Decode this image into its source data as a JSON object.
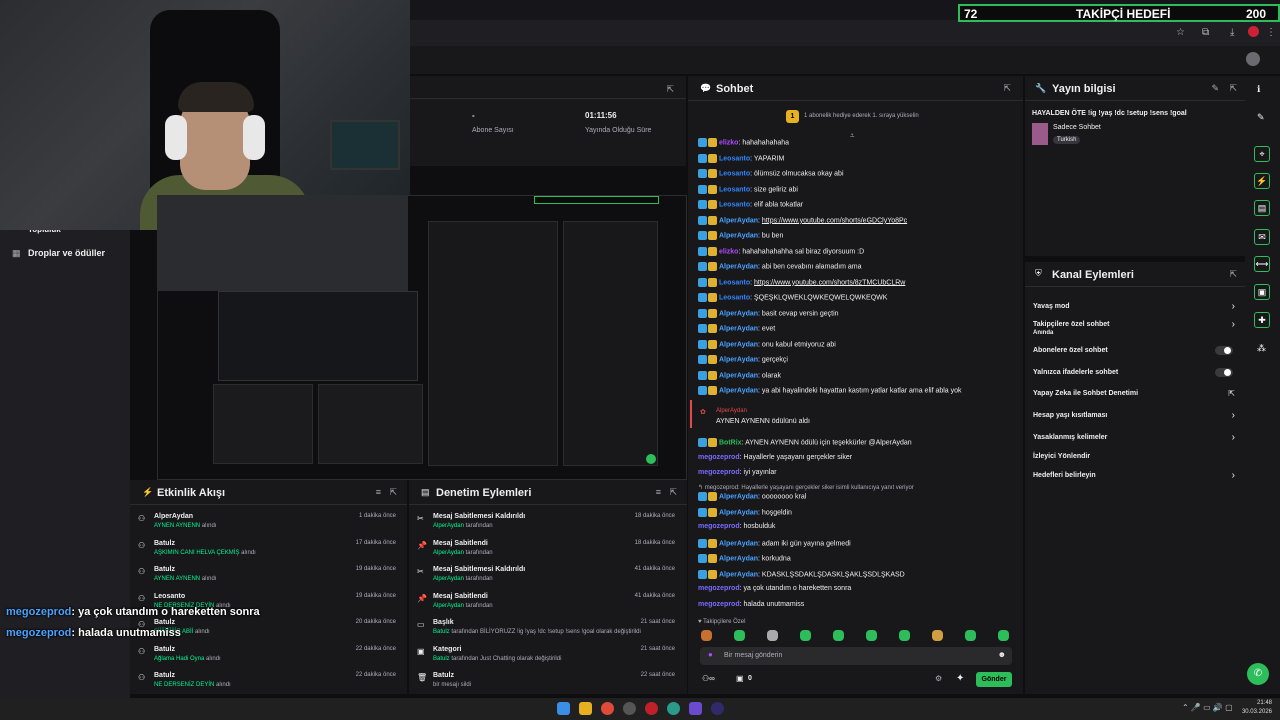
{
  "follow_goal": {
    "count": "72",
    "label": "TAKİPÇİ HEDEFİ",
    "goal": "200"
  },
  "left_nav": {
    "drops_label": "Droplar ve ödüller",
    "top_item": "Topluluk"
  },
  "stats": {
    "followers_value": "-",
    "followers_label": "Abone Sayısı",
    "uptime_value": "01:11:56",
    "uptime_label": "Yayında Olduğu Süre"
  },
  "chat": {
    "title": "Sohbet",
    "pinned": "1 abonelik hediye ederek 1. sıraya yükselin",
    "messages": [
      {
        "user": "elizko",
        "cls": "u-elizko",
        "text": "hahahahahaha"
      },
      {
        "user": "Leosanto",
        "cls": "u-leo",
        "text": "YAPARIM"
      },
      {
        "user": "Leosanto",
        "cls": "u-leo",
        "text": "ölümsüz olmucaksa okay abi"
      },
      {
        "user": "Leosanto",
        "cls": "u-leo",
        "text": "size geliriz abi"
      },
      {
        "user": "Leosanto",
        "cls": "u-leo",
        "text": "elif abla tokatlar"
      },
      {
        "user": "AlperAydan",
        "cls": "u-alper",
        "text": "https://www.youtube.com/shorts/eGDClyYo8Pc",
        "link": true
      },
      {
        "user": "AlperAydan",
        "cls": "u-alper",
        "text": "bu ben"
      },
      {
        "user": "elizko",
        "cls": "u-elizko",
        "text": "hahahahahahha sal biraz diyorsuum :D"
      },
      {
        "user": "AlperAydan",
        "cls": "u-alper",
        "text": "abi ben cevabını alamadım ama"
      },
      {
        "user": "Leosanto",
        "cls": "u-leo",
        "text": "https://www.youtube.com/shorts/8zTMCUbCLRw",
        "link": true
      },
      {
        "user": "Leosanto",
        "cls": "u-leo",
        "text": "ŞQEŞKLQWEKLQWKEQWELQWKEQWK"
      },
      {
        "user": "AlperAydan",
        "cls": "u-alper",
        "text": "basit cevap versin geçtin"
      },
      {
        "user": "AlperAydan",
        "cls": "u-alper",
        "text": "evet"
      },
      {
        "user": "AlperAydan",
        "cls": "u-alper",
        "text": "onu kabul etmiyoruz abi"
      },
      {
        "user": "AlperAydan",
        "cls": "u-alper",
        "text": "gerçekçi"
      },
      {
        "user": "AlperAydan",
        "cls": "u-alper",
        "text": "olarak"
      },
      {
        "user": "AlperAydan",
        "cls": "u-alper",
        "text": "ya abi hayalindeki hayattan kastım yatlar katlar ama elif abla yok"
      }
    ],
    "reward": {
      "user": "AlperAydan",
      "text": "AYNEN AYNENN ödülünü aldı"
    },
    "messages2": [
      {
        "user": "BotRix",
        "cls": "u-botrix",
        "text": "AYNEN AYNENN ödülü için teşekkürler @AlperAydan"
      },
      {
        "user": "megozeprod",
        "cls": "u-mego",
        "text": "Hayallerle yaşayanı gerçekler siker"
      },
      {
        "user": "megozeprod",
        "cls": "u-mego",
        "text": "iyi yayınlar"
      }
    ],
    "reply_ref": "megozeprod: Hayallerle yaşayanı gerçekler siker isimli kullanıcıya yanıt veriyor",
    "messages3": [
      {
        "user": "AlperAydan",
        "cls": "u-alper",
        "text": "oooooooo kral"
      },
      {
        "user": "AlperAydan",
        "cls": "u-alper",
        "text": "hoşgeldin"
      },
      {
        "user": "megozeprod",
        "cls": "u-mego",
        "text": "hosbulduk"
      },
      {
        "user": "AlperAydan",
        "cls": "u-alper",
        "text": "adam iki gün yayına gelmedi"
      },
      {
        "user": "AlperAydan",
        "cls": "u-alper",
        "text": "korkudna"
      },
      {
        "user": "AlperAydan",
        "cls": "u-alper",
        "text": "KDASKLŞSDAKLŞDASKLŞAKLŞSDLŞKASD"
      },
      {
        "user": "megozeprod",
        "cls": "u-mego",
        "text": "ya çok utandım o hareketten sonra"
      },
      {
        "user": "megozeprod",
        "cls": "u-mego",
        "text": "halada unutmamiss"
      }
    ],
    "followers_only": "Takipçilere Özel",
    "input_placeholder": "Bir mesaj gönderin",
    "points": "0",
    "send_label": "Gönder"
  },
  "stream_info": {
    "title": "Yayın bilgisi",
    "stream_title": "HAYALDEN ÖTE !ig !yaş !dc !setup !sens !goal",
    "category": "Sadece Sohbet",
    "tag": "Turkish"
  },
  "channel_actions": {
    "title": "Kanal Eylemleri",
    "items": [
      {
        "label": "Yavaş mod",
        "kind": "arrow"
      },
      {
        "label": "Takipçilere özel sohbet",
        "sub": "Anında",
        "kind": "arrow"
      },
      {
        "label": "Abonelere özel sohbet",
        "kind": "toggle"
      },
      {
        "label": "Yalnızca ifadelerle sohbet",
        "kind": "toggle"
      },
      {
        "label": "Yapay Zeka ile Sohbet Denetimi",
        "kind": "ext"
      },
      {
        "label": "Hesap yaşı kısıtlaması",
        "kind": "arrow"
      },
      {
        "label": "Yasaklanmış kelimeler",
        "kind": "arrow"
      },
      {
        "label": "İzleyici Yönlendir",
        "kind": "none"
      },
      {
        "label": "Hedefleri belirleyin",
        "kind": "arrow"
      }
    ]
  },
  "activity": {
    "title": "Etkinlik Akışı",
    "rows": [
      {
        "name": "AlperAydan",
        "sub": "AYNEN AYNENN",
        "suffix": "alındı",
        "time": "1 dakika önce"
      },
      {
        "name": "Batulz",
        "sub": "AŞKIMIN CANI HELVA ÇEKMİŞ",
        "suffix": "alındı",
        "time": "17 dakika önce"
      },
      {
        "name": "Batulz",
        "sub": "AYNEN AYNENN",
        "suffix": "alındı",
        "time": "19 dakika önce"
      },
      {
        "name": "Leosanto",
        "sub": "NE DERSENİZ DEYİN",
        "suffix": "alındı",
        "time": "19 dakika önce"
      },
      {
        "name": "Batulz",
        "sub": "ŞİİİİİİİİİİİR ABİİ",
        "suffix": "alındı",
        "time": "20 dakika önce"
      },
      {
        "name": "Batulz",
        "sub": "Ağlama Hadi Oyna",
        "suffix": "alındı",
        "time": "22 dakika önce"
      },
      {
        "name": "Batulz",
        "sub": "NE DERSENİZ DEYİN",
        "suffix": "alındı",
        "time": "22 dakika önce"
      }
    ]
  },
  "modlog": {
    "title": "Denetim Eylemleri",
    "rows": [
      {
        "name": "Mesaj Sabitlemesi Kaldırıldı",
        "who": "AlperAydan",
        "sub": "tarafından",
        "time": "18 dakika önce"
      },
      {
        "name": "Mesaj Sabitlendi",
        "who": "AlperAydan",
        "sub": "tarafından",
        "time": "18 dakika önce"
      },
      {
        "name": "Mesaj Sabitlemesi Kaldırıldı",
        "who": "AlperAydan",
        "sub": "tarafından",
        "time": "41 dakika önce"
      },
      {
        "name": "Mesaj Sabitlendi",
        "who": "AlperAydan",
        "sub": "tarafından",
        "time": "41 dakika önce"
      },
      {
        "name": "Başlık",
        "who": "Batulz",
        "sub": "tarafından BİLİYORUZZ !ig !yaş !dc !setup !sens !goal olarak değiştirildi",
        "time": "21 saat önce"
      },
      {
        "name": "Kategori",
        "who": "Batulz",
        "sub": "tarafından Just Chatting olarak değiştirildi",
        "time": "21 saat önce"
      },
      {
        "name": "Batulz",
        "who": "",
        "sub": "bir mesajı sildi",
        "time": "22 saat önce"
      }
    ]
  },
  "overlay_chat": [
    {
      "user": "megozeprod",
      "text": ": ya çok utandım o hareketten sonra"
    },
    {
      "user": "megozeprod",
      "text": ": halada unutmamiss"
    }
  ],
  "taskbar": {
    "time": "21:48",
    "date": "30.03.2026"
  }
}
